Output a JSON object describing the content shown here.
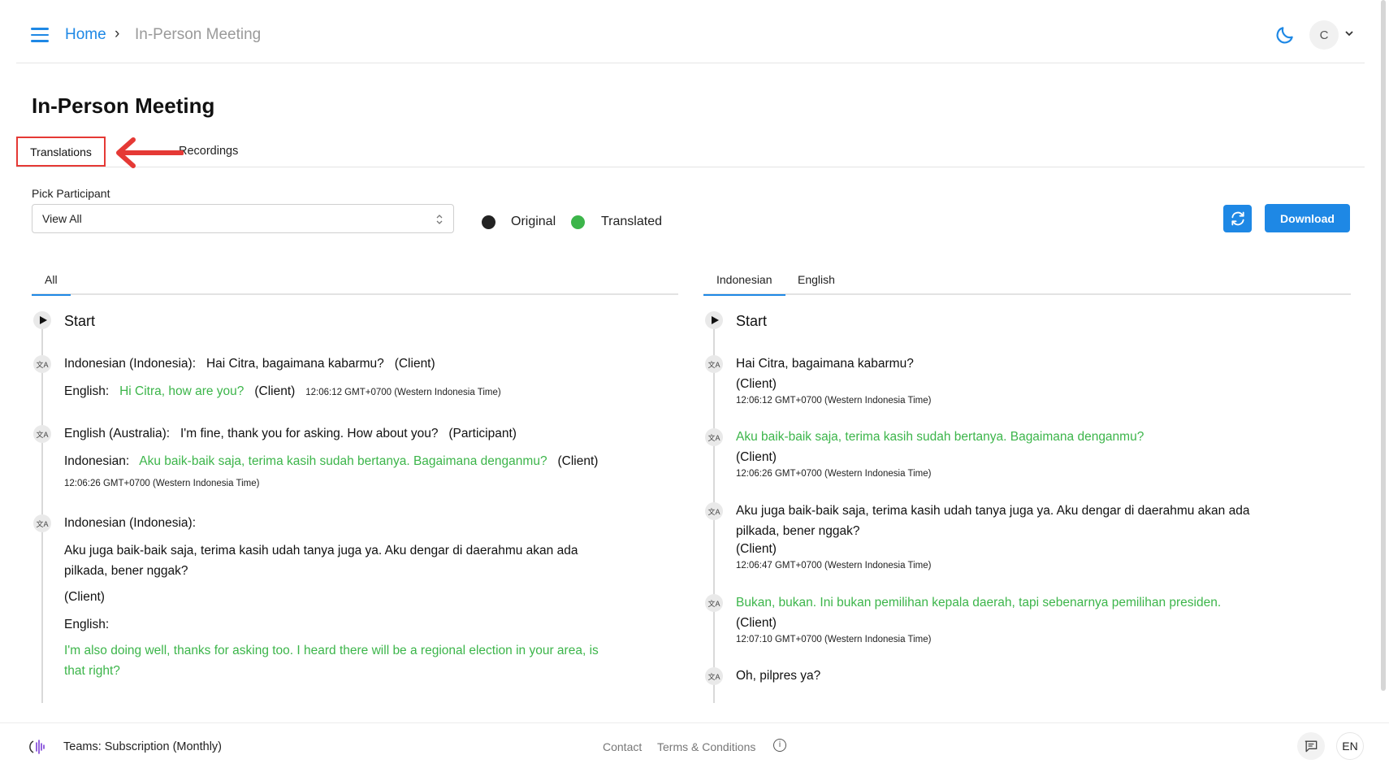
{
  "header": {
    "breadcrumb_home": "Home",
    "breadcrumb_separator": "›",
    "breadcrumb_current": "In-Person Meeting",
    "avatar_initial": "C",
    "icons": [
      "hamburger-menu-icon",
      "moon-icon",
      "chevron-down-icon"
    ]
  },
  "page": {
    "title": "In-Person Meeting",
    "tabs": [
      {
        "label": "Translations",
        "active": true
      },
      {
        "label": "Recordings",
        "active": false
      }
    ]
  },
  "controls": {
    "pick_label": "Pick Participant",
    "select_value": "View All",
    "legend_original": "Original",
    "legend_translated": "Translated",
    "download_label": "Download",
    "colors": {
      "original": "#222222",
      "translated": "#3cb54a",
      "accent": "#1e88e5",
      "annotation": "#e53935"
    }
  },
  "left_panel": {
    "tabs": [
      "All"
    ],
    "start": "Start",
    "entries": [
      {
        "lang": "Indonesian (Indonesia):",
        "original": "Hai Citra, bagaimana kabarmu?",
        "speaker": "(Client)",
        "target_lang": "English:",
        "translated": "Hi Citra, how are you?",
        "target_speaker": "(Client)",
        "timestamp": "12:06:12 GMT+0700 (Western Indonesia Time)"
      },
      {
        "lang": "English (Australia):",
        "original": "I'm fine, thank you for asking. How about you?",
        "speaker": "(Participant)",
        "target_lang": "Indonesian:",
        "translated": "Aku baik-baik saja, terima kasih sudah bertanya. Bagaimana denganmu?",
        "target_speaker": "(Client)",
        "timestamp": "12:06:26 GMT+0700 (Western Indonesia Time)"
      },
      {
        "lang": "Indonesian (Indonesia):",
        "original": "Aku juga baik-baik saja, terima kasih udah tanya juga ya. Aku dengar di daerahmu akan ada pilkada, bener nggak?",
        "speaker": "(Client)",
        "target_lang": "English:",
        "translated": "I'm also doing well, thanks for asking too. I heard there will be a regional election in your area, is that right?"
      }
    ]
  },
  "right_panel": {
    "tabs": [
      "Indonesian",
      "English"
    ],
    "start": "Start",
    "entries": [
      {
        "text": "Hai Citra, bagaimana kabarmu?",
        "translated": false,
        "speaker": "(Client)",
        "timestamp": "12:06:12 GMT+0700 (Western Indonesia Time)"
      },
      {
        "text": "Aku baik-baik saja, terima kasih sudah bertanya. Bagaimana denganmu?",
        "translated": true,
        "speaker": "(Client)",
        "timestamp": "12:06:26 GMT+0700 (Western Indonesia Time)"
      },
      {
        "text": "Aku juga baik-baik saja, terima kasih udah tanya juga ya. Aku dengar di daerahmu akan ada pilkada, bener nggak?",
        "translated": false,
        "speaker": "(Client)",
        "timestamp": "12:06:47 GMT+0700 (Western Indonesia Time)"
      },
      {
        "text": "Bukan, bukan. Ini bukan pemilihan kepala daerah, tapi sebenarnya pemilihan presiden.",
        "translated": true,
        "speaker": "(Client)",
        "timestamp": "12:07:10 GMT+0700 (Western Indonesia Time)"
      },
      {
        "text": "Oh, pilpres ya?",
        "translated": false
      }
    ]
  },
  "footer": {
    "plan": "Teams: Subscription (Monthly)",
    "contact": "Contact",
    "terms": "Terms & Conditions",
    "info_glyph": "i",
    "lang": "EN"
  }
}
